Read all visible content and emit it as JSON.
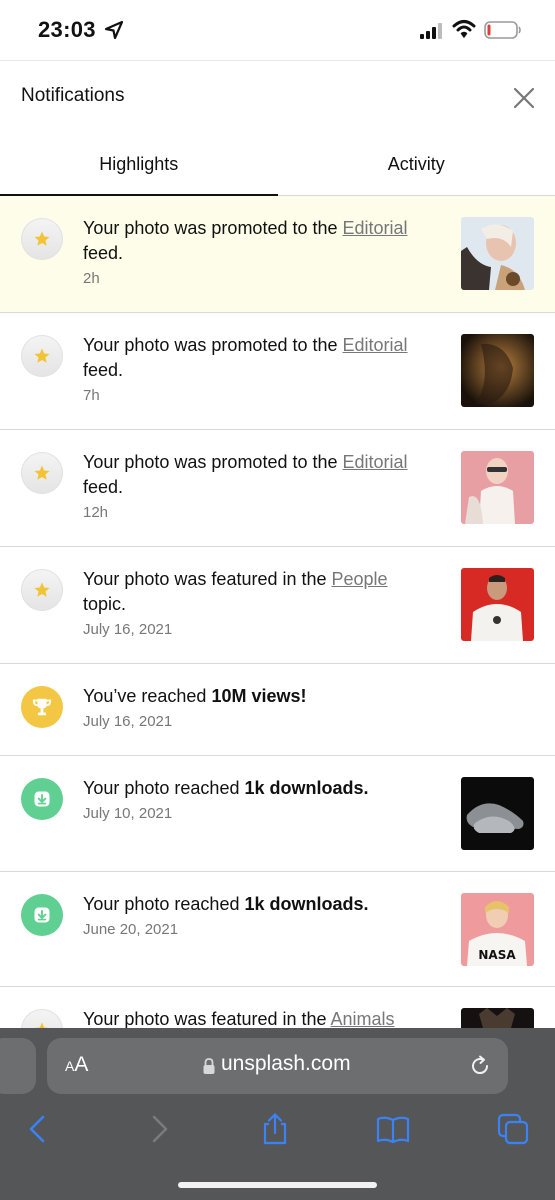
{
  "status_bar": {
    "time": "23:03"
  },
  "header": {
    "title": "Notifications"
  },
  "tabs": [
    {
      "label": "Highlights",
      "active": true
    },
    {
      "label": "Activity",
      "active": false
    }
  ],
  "notifications": [
    {
      "icon": "star-icon",
      "text_before": "Your photo was promoted to the ",
      "link": "Editorial",
      "text_after": " feed.",
      "time": "2h",
      "highlighted": true,
      "thumbnail": "photo-woman-tattoos"
    },
    {
      "icon": "star-icon",
      "text_before": "Your photo was promoted to the ",
      "link": "Editorial",
      "text_after": " feed.",
      "time": "7h",
      "highlighted": false,
      "thumbnail": "photo-woman-shadow"
    },
    {
      "icon": "star-icon",
      "text_before": "Your photo was promoted to the ",
      "link": "Editorial",
      "text_after": " feed.",
      "time": "12h",
      "highlighted": false,
      "thumbnail": "photo-woman-pink-background"
    },
    {
      "icon": "star-icon",
      "text_before": "Your photo was featured in the ",
      "link": "People",
      "text_after": " topic.",
      "time": "July 16, 2021",
      "highlighted": false,
      "thumbnail": "photo-man-white-hoodie"
    },
    {
      "icon": "trophy-icon",
      "text_before": "You’ve reached ",
      "bold": "10M views!",
      "text_after": "",
      "time": "July 16, 2021",
      "highlighted": false,
      "thumbnail": null
    },
    {
      "icon": "download-icon",
      "text_before": "Your photo reached ",
      "bold": "1k downloads.",
      "text_after": "",
      "time": "July 10, 2021",
      "highlighted": false,
      "thumbnail": "photo-grey-sneakers"
    },
    {
      "icon": "download-icon",
      "text_before": "Your photo reached ",
      "bold": "1k downloads.",
      "text_after": "",
      "time": "June 20, 2021",
      "highlighted": false,
      "thumbnail": "photo-woman-nasa-shirt"
    },
    {
      "icon": "star-icon",
      "text_before": "Your photo was featured in the ",
      "link": "Animals",
      "text_after": "",
      "time": "",
      "highlighted": false,
      "thumbnail": "photo-animal-dark"
    }
  ],
  "browser": {
    "aa_small": "A",
    "aa_large": "A",
    "url": "unsplash.com"
  },
  "colors": {
    "highlight_bg": "#fefde9",
    "star": "#f2c335",
    "trophy_bg": "#f3c744",
    "download_bg": "#5fcf92",
    "toolbar_blue": "#3b82f6"
  }
}
